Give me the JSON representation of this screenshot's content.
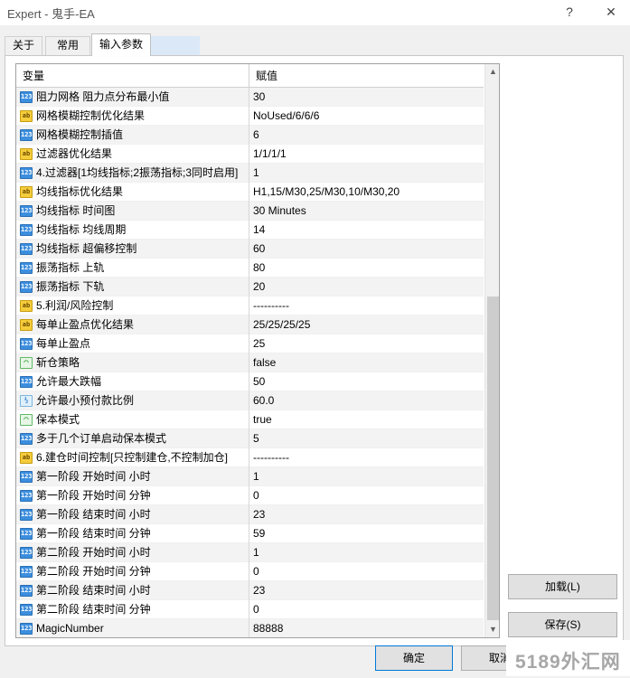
{
  "window": {
    "title": "Expert - 鬼手-EA",
    "help_glyph": "?",
    "close_glyph": "✕"
  },
  "tabs": [
    {
      "label": "关于"
    },
    {
      "label": "常用"
    },
    {
      "label": "输入参数"
    },
    {
      "label": ""
    }
  ],
  "grid": {
    "col_variable": "变量",
    "col_value": "赋值",
    "rows": [
      {
        "icon": "int",
        "name": "阻力网格 阻力点分布最小值",
        "value": "30"
      },
      {
        "icon": "str",
        "name": "网格模糊控制优化结果",
        "value": "NoUsed/6/6/6"
      },
      {
        "icon": "int",
        "name": "网格模糊控制插值",
        "value": "6"
      },
      {
        "icon": "str",
        "name": "过滤器优化结果",
        "value": "1/1/1/1"
      },
      {
        "icon": "int",
        "name": "4.过滤器[1均线指标;2振荡指标;3同时启用]",
        "value": "1"
      },
      {
        "icon": "str",
        "name": "均线指标优化结果",
        "value": "H1,15/M30,25/M30,10/M30,20"
      },
      {
        "icon": "int",
        "name": "均线指标 时间图",
        "value": "30 Minutes"
      },
      {
        "icon": "int",
        "name": "均线指标 均线周期",
        "value": "14"
      },
      {
        "icon": "int",
        "name": "均线指标 超偏移控制",
        "value": "60"
      },
      {
        "icon": "int",
        "name": "振荡指标 上轨",
        "value": "80"
      },
      {
        "icon": "int",
        "name": "振荡指标 下轨",
        "value": "20"
      },
      {
        "icon": "str",
        "name": "5.利润/风险控制",
        "value": "----------"
      },
      {
        "icon": "str",
        "name": "每单止盈点优化结果",
        "value": "25/25/25/25"
      },
      {
        "icon": "int",
        "name": "每单止盈点",
        "value": "25"
      },
      {
        "icon": "bool",
        "name": "斩仓策略",
        "value": "false"
      },
      {
        "icon": "int",
        "name": "允许最大跌幅",
        "value": "50"
      },
      {
        "icon": "dbl",
        "name": "允许最小预付款比例",
        "value": "60.0"
      },
      {
        "icon": "bool",
        "name": "保本模式",
        "value": "true"
      },
      {
        "icon": "int",
        "name": "多于几个订单启动保本模式",
        "value": "5"
      },
      {
        "icon": "str",
        "name": "6.建仓时间控制[只控制建仓,不控制加仓]",
        "value": "----------"
      },
      {
        "icon": "int",
        "name": "第一阶段 开始时间 小时",
        "value": "1"
      },
      {
        "icon": "int",
        "name": "第一阶段 开始时间 分钟",
        "value": "0"
      },
      {
        "icon": "int",
        "name": "第一阶段 结束时间 小时",
        "value": "23"
      },
      {
        "icon": "int",
        "name": "第一阶段 结束时间 分钟",
        "value": "59"
      },
      {
        "icon": "int",
        "name": "第二阶段 开始时间 小时",
        "value": "1"
      },
      {
        "icon": "int",
        "name": "第二阶段 开始时间 分钟",
        "value": "0"
      },
      {
        "icon": "int",
        "name": "第二阶段 结束时间 小时",
        "value": "23"
      },
      {
        "icon": "int",
        "name": "第二阶段 结束时间 分钟",
        "value": "0"
      },
      {
        "icon": "int",
        "name": "MagicNumber",
        "value": "88888"
      }
    ]
  },
  "icon_glyphs": {
    "int": "123",
    "str": "ab",
    "bool": "⌒",
    "dbl": "½"
  },
  "buttons": {
    "load": "加载(L)",
    "save": "保存(S)",
    "ok": "确定",
    "cancel": "取消"
  },
  "watermark": "5189外汇网"
}
